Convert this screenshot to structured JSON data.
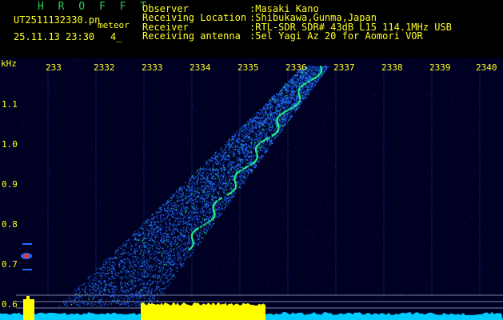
{
  "header": {
    "title": "H R O F F T",
    "filename": "UT2511132330.pn",
    "meteor_label": "meteor",
    "datetime": "25.11.13 23:30",
    "count": "4_",
    "observer_label": "Observer",
    "observer_value": ":Masaki Kano",
    "location_label": "Receiving Location",
    "location_value": ":Shibukawa,Gunma,Japan",
    "receiver_label": "Receiver",
    "receiver_value": ":RTL-SDR SDR# 43dB L15 114.1MHz USB",
    "antenna_label": "Receiving antenna",
    "antenna_value": ":5el Yagi Az 20 for Aomori VOR"
  },
  "axes": {
    "y_unit": "kHz",
    "y_ticks": [
      "1.1",
      "1.0",
      "0.9",
      "0.8",
      "0.7",
      "0.6"
    ],
    "x_ticks": [
      "233",
      "2332",
      "2333",
      "2334",
      "2335",
      "2336",
      "2337",
      "2338",
      "2339",
      "2340"
    ]
  },
  "colors": {
    "background": "#000022",
    "text": "#ffff22",
    "title": "#2ecc55",
    "echo": "#1e6cff",
    "echo_core": "#22ee88",
    "baseline": "#ffff00",
    "noise": "#00ccff"
  }
}
